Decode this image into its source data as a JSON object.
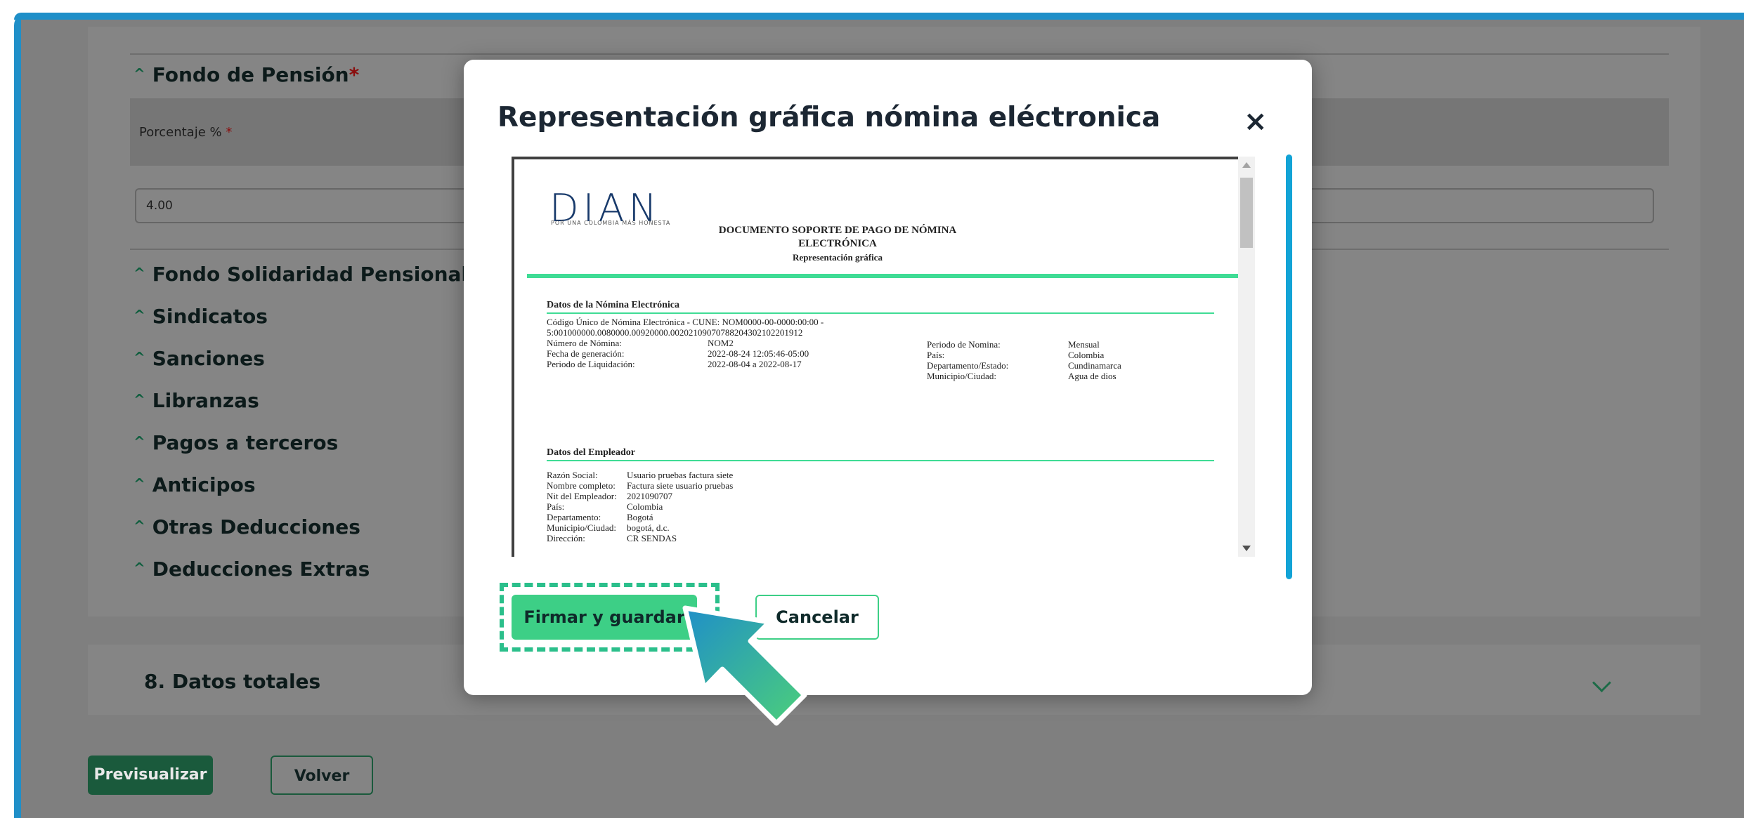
{
  "sections": {
    "fondo_pension": "Fondo de Pensión",
    "fondo_pension_required": "*",
    "porcentaje_label": "Porcentaje %",
    "porcentaje_required": "*",
    "porcentaje_value": "4.00",
    "items": [
      "Fondo Solidaridad Pensional",
      "Sindicatos",
      "Sanciones",
      "Libranzas",
      "Pagos a terceros",
      "Anticipos",
      "Otras Deducciones",
      "Deducciones Extras"
    ],
    "datos_totales": "8. Datos totales"
  },
  "footer": {
    "previsualizar": "Previsualizar",
    "volver": "Volver"
  },
  "modal": {
    "title": "Representación gráfica nómina eléctronica",
    "close": "×",
    "firmar": "Firmar y guardar",
    "cancelar": "Cancelar"
  },
  "document": {
    "logo": "DIAN",
    "logo_sub": "POR UNA COLOMBIA MÁS HONESTA",
    "title_line1": "DOCUMENTO SOPORTE DE PAGO DE NÓMINA",
    "title_line2": "ELECTRÓNICA",
    "subtitle": "Representación gráfica",
    "nomina_section": "Datos de la Nómina Electrónica",
    "cune_line1": "Código Único de Nómina Electrónica - CUNE: NOM0000-00-0000:00:00 -",
    "cune_line2": "5:001000000.0080000.00920000.00202109070788204302102201912",
    "numero_label": "Número de Nómina:",
    "numero_value": "NOM2",
    "fecha_label": "Fecha de generación:",
    "fecha_value": "2022-08-24 12:05:46-05:00",
    "periodo_liq_label": "Periodo de Liquidación:",
    "periodo_liq_value": "2022-08-04 a 2022-08-17",
    "periodo_nom_label": "Periodo de Nomina:",
    "periodo_nom_value": "Mensual",
    "pais_label": "País:",
    "pais_value": "Colombia",
    "depto_label": "Departamento/Estado:",
    "depto_value": "Cundinamarca",
    "municipio_label": "Municipio/Ciudad:",
    "municipio_value": "Agua de dios",
    "empleador_section": "Datos del Empleador",
    "razon_label": "Razón Social:",
    "razon_value": "Usuario pruebas factura siete",
    "nombre_label": "Nombre completo:",
    "nombre_value": "Factura siete usuario pruebas",
    "nit_label": "Nit del Empleador:",
    "nit_value": "2021090707",
    "emp_pais_label": "País:",
    "emp_pais_value": "Colombia",
    "emp_depto_label": "Departamento:",
    "emp_depto_value": "Bogotá",
    "emp_mun_label": "Municipio/Ciudad:",
    "emp_mun_value": "bogotá, d.c.",
    "dir_label": "Dirección:",
    "dir_value": "CR SENDAS"
  }
}
